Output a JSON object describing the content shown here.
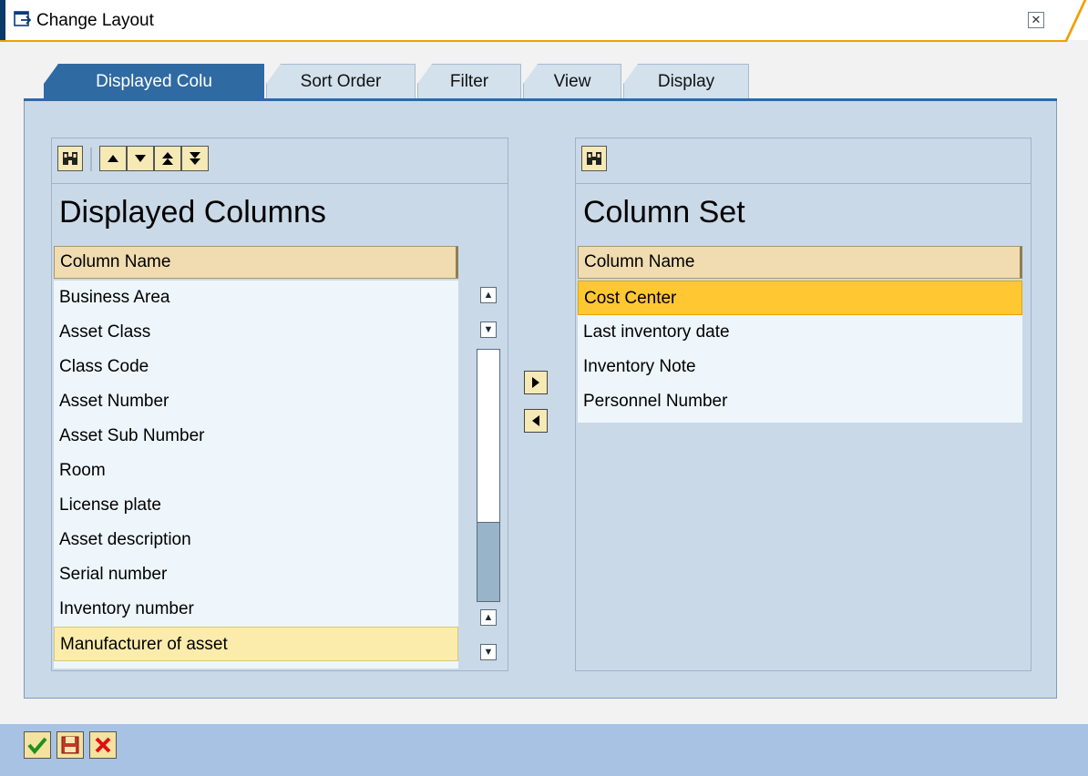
{
  "window": {
    "title": "Change Layout",
    "close_glyph": "✕"
  },
  "tabs": [
    {
      "label": "Displayed Colu",
      "active": true
    },
    {
      "label": "Sort Order",
      "active": false
    },
    {
      "label": "Filter",
      "active": false
    },
    {
      "label": "View",
      "active": false
    },
    {
      "label": "Display",
      "active": false
    }
  ],
  "left_panel": {
    "heading": "Displayed Columns",
    "column_header": "Column Name",
    "toolbar_icons": [
      "find-icon",
      "move-up-icon",
      "move-down-icon",
      "move-top-icon",
      "move-bottom-icon"
    ],
    "rows": [
      "Business Area",
      "Asset Class",
      "Class Code",
      "Asset Number",
      "Asset Sub Number",
      "Room",
      "License plate",
      "Asset description",
      "Serial number",
      "Inventory number",
      "Manufacturer of asset"
    ],
    "selected_row": "Manufacturer of asset"
  },
  "right_panel": {
    "heading": "Column Set",
    "column_header": "Column Name",
    "toolbar_icons": [
      "find-icon"
    ],
    "rows": [
      "Cost Center",
      "Last inventory date",
      "Inventory Note",
      "Personnel Number"
    ],
    "selected_row": "Cost Center"
  },
  "move_buttons": [
    "move-right-icon",
    "move-left-icon"
  ],
  "footer_buttons": [
    "confirm-icon",
    "save-icon",
    "cancel-icon"
  ],
  "colors": {
    "tab_active": "#2f6aa3",
    "panel_bg": "#cad9e7",
    "list_bg": "#eef6fc",
    "header_bg": "#f0dcb0",
    "left_selection": "#fbecab",
    "right_selection": "#ffc833",
    "footer_bg": "#a7c2e2"
  }
}
